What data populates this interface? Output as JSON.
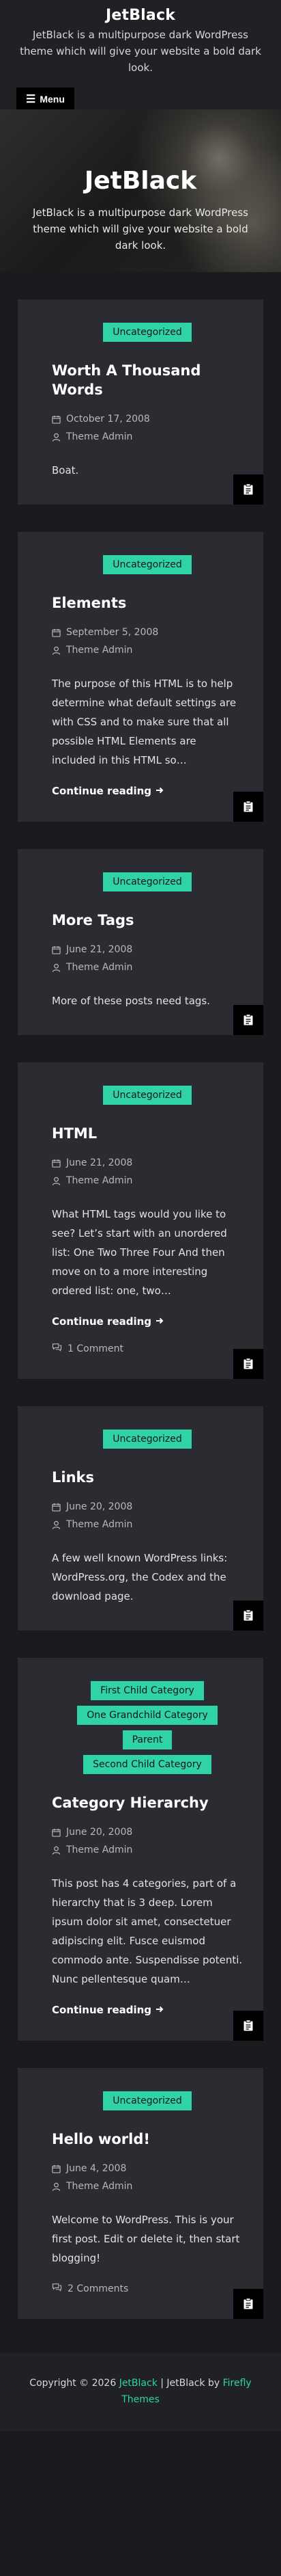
{
  "site": {
    "title": "JetBlack",
    "tagline": "JetBlack is a multipurpose dark WordPress theme which will give your website a bold dark look.",
    "menu_label": "Menu"
  },
  "hero": {
    "title": "JetBlack",
    "description": "JetBlack is a multipurpose dark WordPress theme which will give your website a bold dark look."
  },
  "posts": [
    {
      "categories": [
        "Uncategorized"
      ],
      "title": "Worth A Thousand Words",
      "date": "October 17, 2008",
      "author": "Theme Admin",
      "excerpt": "Boat."
    },
    {
      "categories": [
        "Uncategorized"
      ],
      "title": "Elements",
      "date": "September 5, 2008",
      "author": "Theme Admin",
      "excerpt": "The purpose of this HTML is to help determine what default settings are with CSS and to make sure that all possible HTML Elements are included in this HTML so…",
      "more": "Continue reading"
    },
    {
      "categories": [
        "Uncategorized"
      ],
      "title": "More Tags",
      "date": "June 21, 2008",
      "author": "Theme Admin",
      "excerpt": "More of these posts need tags."
    },
    {
      "categories": [
        "Uncategorized"
      ],
      "title": "HTML",
      "date": "June 21, 2008",
      "author": "Theme Admin",
      "excerpt": "What HTML tags would you like to see? Let’s start with an unordered list: One Two Three Four And then move on to a more interesting ordered list: one, two…",
      "more": "Continue reading",
      "comments": "1 Comment"
    },
    {
      "categories": [
        "Uncategorized"
      ],
      "title": "Links",
      "date": "June 20, 2008",
      "author": "Theme Admin",
      "excerpt": "A few well known WordPress links: WordPress.org, the Codex and the download page."
    },
    {
      "categories": [
        "First Child Category",
        "One Grandchild Category",
        "Parent",
        "Second Child Category"
      ],
      "title": "Category Hierarchy",
      "date": "June 20, 2008",
      "author": "Theme Admin",
      "excerpt": "This post has 4 categories, part of a hierarchy that is 3 deep. Lorem ipsum dolor sit amet, consectetuer adipiscing elit. Fusce euismod commodo ante. Suspendisse potenti. Nunc pellentesque quam…",
      "more": "Continue reading"
    },
    {
      "categories": [
        "Uncategorized"
      ],
      "title": "Hello world!",
      "date": "June 4, 2008",
      "author": "Theme Admin",
      "excerpt": "Welcome to WordPress. This is your first post. Edit or delete it, then start blogging!",
      "comments": "2 Comments"
    }
  ],
  "footer": {
    "prefix": "Copyright © 2026 ",
    "site_link": "JetBlack",
    "middle": " | JetBlack by ",
    "theme_link": "Firefly Themes"
  },
  "colors": {
    "accent": "#2fd3a5",
    "card": "#2b2c31",
    "page": "#1a1b1f"
  }
}
